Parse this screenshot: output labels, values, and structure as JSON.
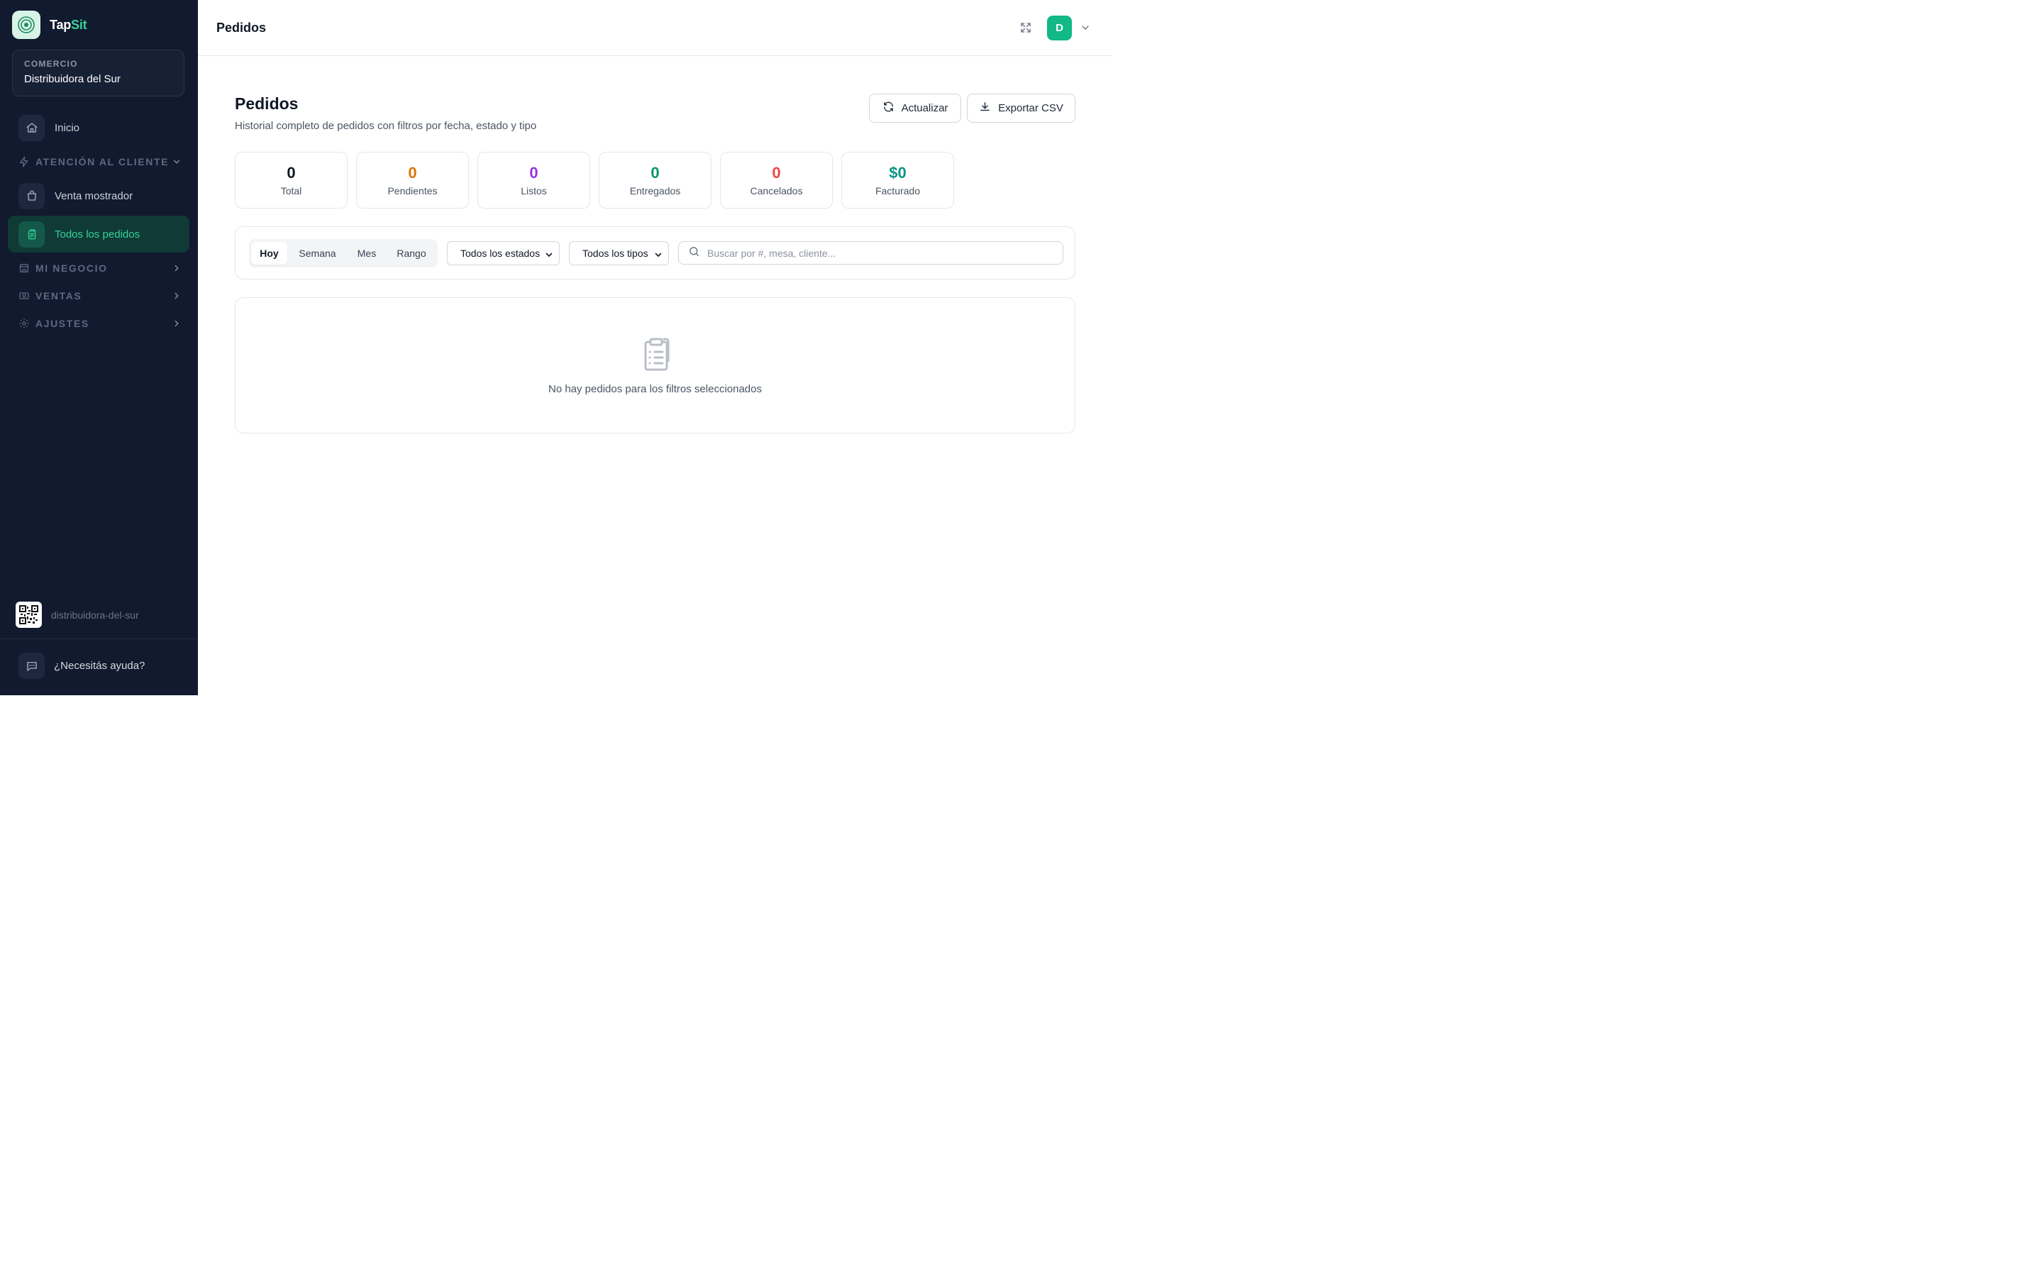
{
  "brand": {
    "name_part1": "Tap",
    "name_part2": "Sit",
    "accent_color": "#34d399"
  },
  "store": {
    "label": "COMERCIO",
    "name": "Distribuidora del Sur"
  },
  "sidebar": {
    "home": {
      "label": "Inicio",
      "icon": "home-icon"
    },
    "sections": [
      {
        "label": "ATENCIÓN AL CLIENTE",
        "icon": "bolt-icon",
        "expanded": true
      },
      {
        "label": "MI NEGOCIO",
        "icon": "store-icon",
        "expanded": false
      },
      {
        "label": "VENTAS",
        "icon": "cash-icon",
        "expanded": false
      },
      {
        "label": "AJUSTES",
        "icon": "gear-icon",
        "expanded": false
      }
    ],
    "items": [
      {
        "label": "Venta mostrador",
        "icon": "shopping-bag-icon",
        "active": false
      },
      {
        "label": "Todos los pedidos",
        "icon": "orders-icon",
        "active": true
      }
    ],
    "slug": "distribuidora-del-sur",
    "help": "¿Necesitás ayuda?"
  },
  "header": {
    "title": "Pedidos",
    "avatar_initial": "D"
  },
  "main": {
    "title": "Pedidos",
    "subtitle": "Historial completo de pedidos con filtros por fecha, estado y tipo",
    "refresh_label": "Actualizar",
    "export_label": "Exportar CSV",
    "stats": [
      {
        "value": "0",
        "label": "Total",
        "color": "#111827"
      },
      {
        "value": "0",
        "label": "Pendientes",
        "color": "#d97706"
      },
      {
        "value": "0",
        "label": "Listos",
        "color": "#9333ea"
      },
      {
        "value": "0",
        "label": "Entregados",
        "color": "#059669"
      },
      {
        "value": "0",
        "label": "Cancelados",
        "color": "#ef4444"
      },
      {
        "value": "$0",
        "label": "Facturado",
        "color": "#0d9488"
      }
    ],
    "periods": [
      "Hoy",
      "Semana",
      "Mes",
      "Rango"
    ],
    "selected_period": "Hoy",
    "status_filter": "Todos los estados",
    "type_filter": "Todos los tipos",
    "search_placeholder": "Buscar por #, mesa, cliente...",
    "empty_message": "No hay pedidos para los filtros seleccionados"
  }
}
